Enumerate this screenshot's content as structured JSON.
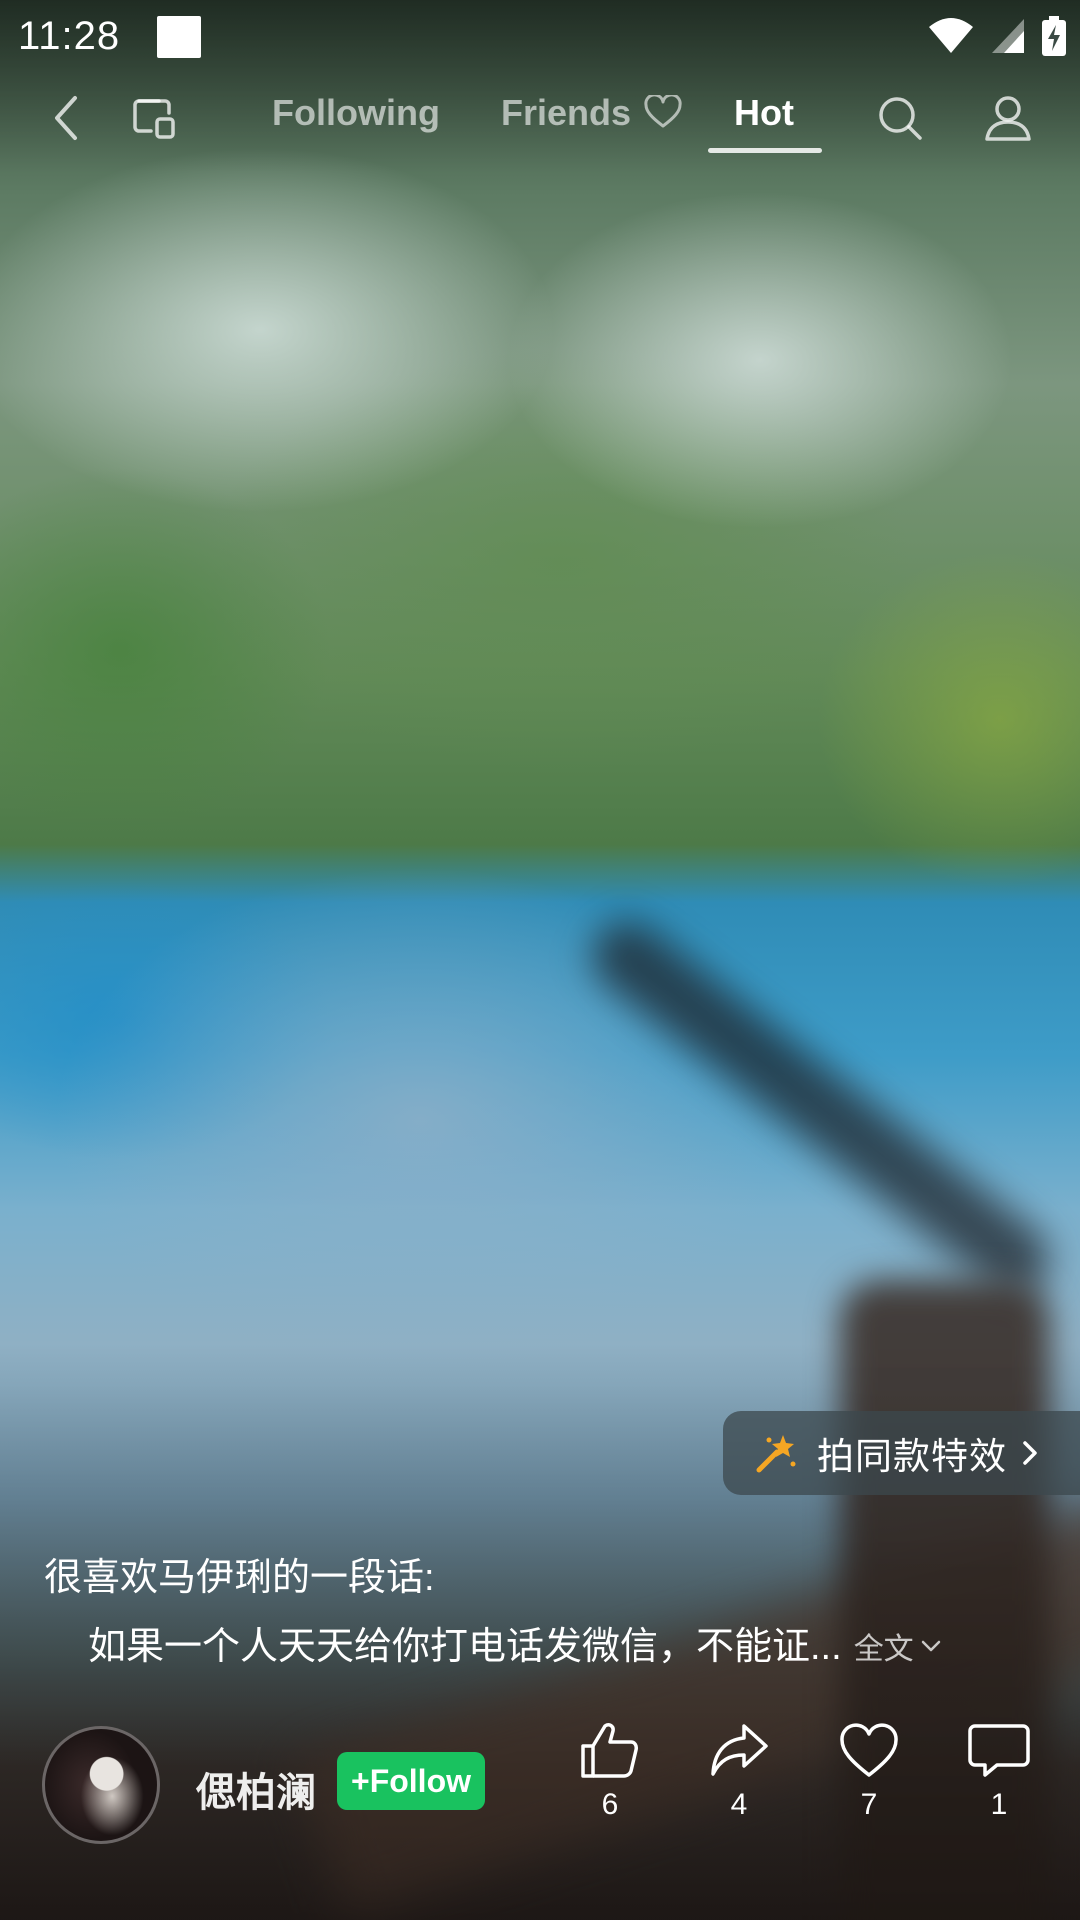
{
  "status_bar": {
    "time": "11:28"
  },
  "nav": {
    "tabs": [
      {
        "label": "Following"
      },
      {
        "label": "Friends"
      },
      {
        "label": "Hot"
      }
    ],
    "active_tab": "Hot"
  },
  "effect_button": {
    "label": "拍同款特效"
  },
  "caption": {
    "line1": "很喜欢马伊琍的一段话:",
    "line2": "如果一个人天天给你打电话发微信，不能证...",
    "expand_label": "全文"
  },
  "author": {
    "name": "偲柏澜",
    "follow_label": "+Follow"
  },
  "actions": {
    "like_count": "6",
    "share_count": "4",
    "favorite_count": "7",
    "comment_count": "1"
  },
  "colors": {
    "follow_green": "#19c25f",
    "effect_icon_orange": "#f5a623"
  }
}
